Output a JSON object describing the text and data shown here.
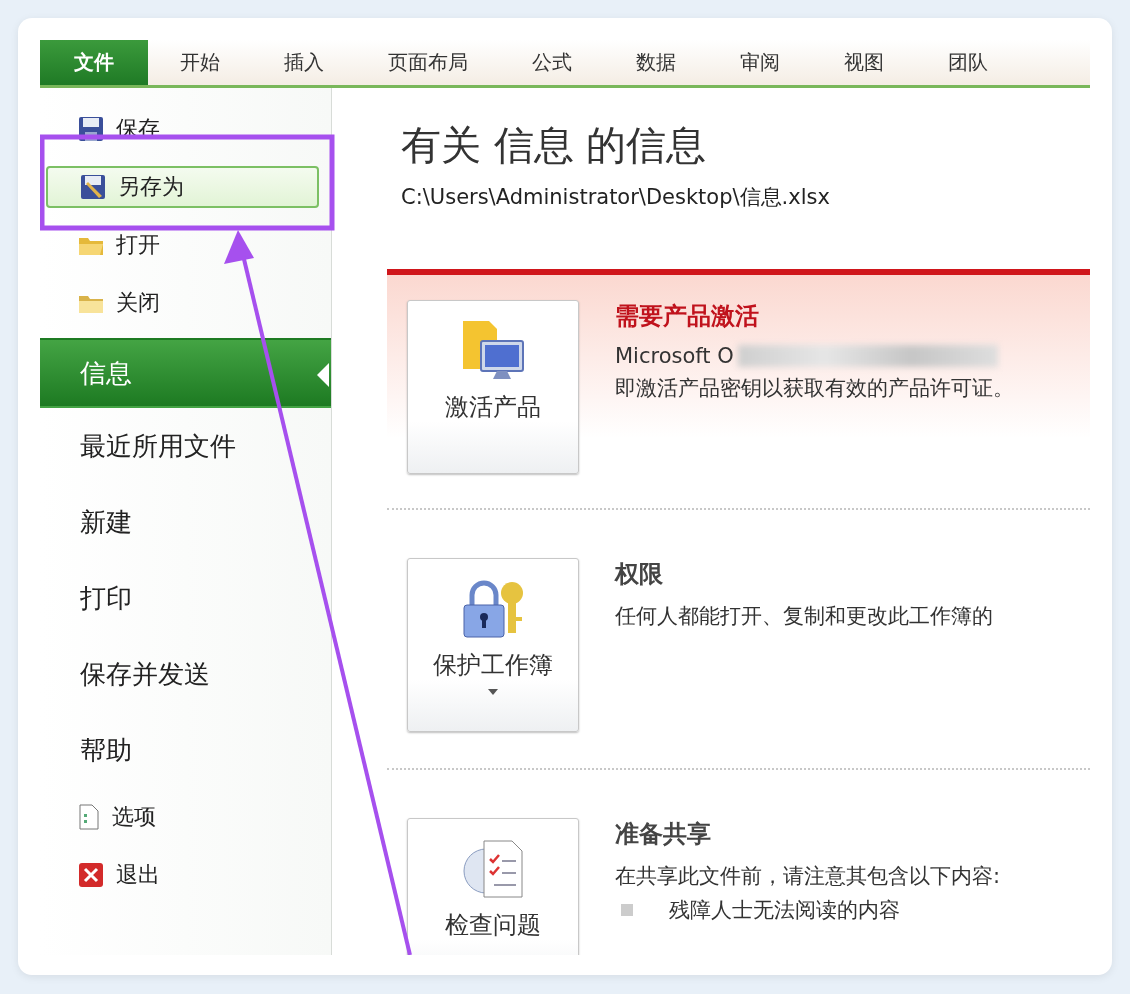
{
  "ribbon_tabs": [
    {
      "label": "文件",
      "selected": true
    },
    {
      "label": "开始",
      "selected": false
    },
    {
      "label": "插入",
      "selected": false
    },
    {
      "label": "页面布局",
      "selected": false
    },
    {
      "label": "公式",
      "selected": false
    },
    {
      "label": "数据",
      "selected": false
    },
    {
      "label": "审阅",
      "selected": false
    },
    {
      "label": "视图",
      "selected": false
    },
    {
      "label": "团队",
      "selected": false
    }
  ],
  "backstage_menu": [
    {
      "label": "保存",
      "kind": "command",
      "selected": false,
      "highlighted": false
    },
    {
      "label": "另存为",
      "kind": "command",
      "selected": false,
      "highlighted": true
    },
    {
      "label": "打开",
      "kind": "command",
      "selected": false,
      "highlighted": false
    },
    {
      "label": "关闭",
      "kind": "command",
      "selected": false,
      "highlighted": false
    },
    {
      "label": "信息",
      "kind": "page",
      "selected": true,
      "highlighted": false
    },
    {
      "label": "最近所用文件",
      "kind": "page",
      "selected": false,
      "highlighted": false
    },
    {
      "label": "新建",
      "kind": "page",
      "selected": false,
      "highlighted": false
    },
    {
      "label": "打印",
      "kind": "page",
      "selected": false,
      "highlighted": false
    },
    {
      "label": "保存并发送",
      "kind": "page",
      "selected": false,
      "highlighted": false
    },
    {
      "label": "帮助",
      "kind": "page",
      "selected": false,
      "highlighted": false
    },
    {
      "label": "选项",
      "kind": "command",
      "selected": false,
      "highlighted": false
    },
    {
      "label": "退出",
      "kind": "command",
      "selected": false,
      "highlighted": false
    }
  ],
  "info": {
    "title": "有关 信息 的信息",
    "path": "C:\\Users\\Administrator\\Desktop\\信息.xlsx",
    "sections": [
      {
        "kind": "alert",
        "button": {
          "label": "激活产品"
        },
        "heading": "需要产品激活",
        "lines": [
          "Microsoft O",
          "即激活产品密钥以获取有效的产品许可证。"
        ],
        "blurred": true
      },
      {
        "kind": "normal",
        "button": {
          "label": "保护工作簿",
          "dropdown": true
        },
        "heading": "权限",
        "lines": [
          "任何人都能打开、复制和更改此工作簿的"
        ]
      },
      {
        "kind": "normal",
        "button": {
          "label": "检查问题"
        },
        "heading": "准备共享",
        "lines": [
          "在共享此文件前，请注意其包含以下内容:"
        ],
        "bullets": [
          "残障人士无法阅读的内容"
        ]
      }
    ]
  }
}
